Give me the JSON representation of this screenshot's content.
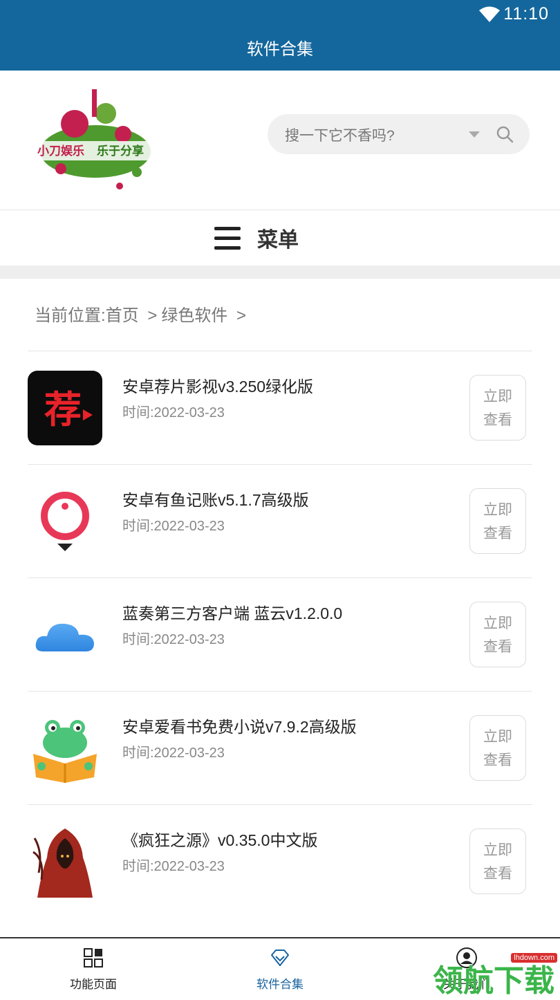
{
  "status_bar": {
    "time": "11:10"
  },
  "title_bar": {
    "title": "软件合集"
  },
  "header": {
    "logo_text": "小刀娱乐 乐于分享",
    "search_placeholder": "搜一下它不香吗?"
  },
  "menu": {
    "label": "菜单"
  },
  "breadcrumb": {
    "prefix": "当前位置:",
    "home": "首页",
    "sep": ">",
    "category": "绿色软件",
    "trail": ">"
  },
  "items": [
    {
      "title": "安卓荐片影视v3.250绿化版",
      "date": "时间:2022-03-23",
      "icon": "jianpian-app-icon",
      "btn_line1": "立即",
      "btn_line2": "查看"
    },
    {
      "title": "安卓有鱼记账v5.1.7高级版",
      "date": "时间:2022-03-23",
      "icon": "youyu-app-icon",
      "btn_line1": "立即",
      "btn_line2": "查看"
    },
    {
      "title": "蓝奏第三方客户端 蓝云v1.2.0.0",
      "date": "时间:2022-03-23",
      "icon": "cloud-app-icon",
      "btn_line1": "立即",
      "btn_line2": "查看"
    },
    {
      "title": "安卓爱看书免费小说v7.9.2高级版",
      "date": "时间:2022-03-23",
      "icon": "frog-book-app-icon",
      "btn_line1": "立即",
      "btn_line2": "查看"
    },
    {
      "title": "《疯狂之源》v0.35.0中文版",
      "date": "时间:2022-03-23",
      "icon": "hooded-figure-game-icon",
      "btn_line1": "立即",
      "btn_line2": "查看"
    }
  ],
  "bottom_nav": [
    {
      "label": "功能页面",
      "icon": "grid-icon"
    },
    {
      "label": "软件合集",
      "icon": "diamond-icon",
      "active": true
    },
    {
      "label": "关于我们",
      "icon": "user-icon"
    }
  ],
  "watermark": {
    "text": "领航下载",
    "url": "lhdown.com"
  },
  "colors": {
    "primary": "#14679c",
    "active_tab": "#1a63a0",
    "watermark_green": "#3bb54a"
  }
}
